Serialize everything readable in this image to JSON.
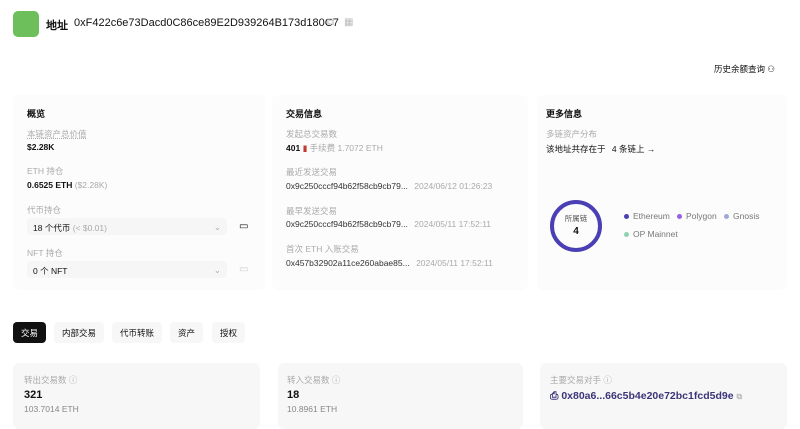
{
  "header": {
    "title": "地址",
    "address": "0xF422c6e73Dacd0C86ce89E2D939264B173d180C7",
    "history_link": "历史余额查询"
  },
  "overview": {
    "title": "概览",
    "total_label": "本链资产总价值",
    "total_value": "$2.28K",
    "eth_label": "ETH 持仓",
    "eth_value": "0.6525 ETH",
    "eth_usd": "($2.28K)",
    "token_label": "代币持仓",
    "token_value": "18 个代币",
    "token_usd": "(< $0.01)",
    "nft_label": "NFT 持仓",
    "nft_value": "0 个 NFT"
  },
  "tx_info": {
    "title": "交易信息",
    "count_label": "发起总交易数",
    "count": "401",
    "fee": "手续费 1.7072 ETH",
    "latest_label": "最近发送交易",
    "latest_hash": "0x9c250cccf94b62f58cb9cb79...",
    "latest_time": "2024/06/12 01:26:23",
    "earliest_label": "最早发送交易",
    "earliest_hash": "0x9c250cccf94b62f58cb9cb79...",
    "earliest_time": "2024/05/11 17:52:11",
    "first_in_label": "首次 ETH 入账交易",
    "first_in_hash": "0x457b32902a11ce260abae85...",
    "first_in_time": "2024/05/11 17:52:11"
  },
  "more": {
    "title": "更多信息",
    "dist_label": "多链资产分布",
    "dist_text": "该地址共存在于",
    "chains_link": "4 条链上 →",
    "donut_label": "所属链",
    "donut_value": "4",
    "legend": [
      {
        "name": "Ethereum",
        "color": "#4a3fb5"
      },
      {
        "name": "Polygon",
        "color": "#9b5de5"
      },
      {
        "name": "Gnosis",
        "color": "#9fa8d8"
      },
      {
        "name": "OP Mainnet",
        "color": "#8fd1b0"
      }
    ]
  },
  "tabs": [
    "交易",
    "内部交易",
    "代币转账",
    "资产",
    "授权"
  ],
  "cards": {
    "out_label": "转出交易数",
    "out_count": "321",
    "out_eth": "103.7014 ETH",
    "in_label": "转入交易数",
    "in_count": "18",
    "in_eth": "10.8961 ETH",
    "cp_label": "主要交易对手",
    "cp_addr": "0x80a6...66c5b4e20e72bc1fcd5d9e"
  }
}
